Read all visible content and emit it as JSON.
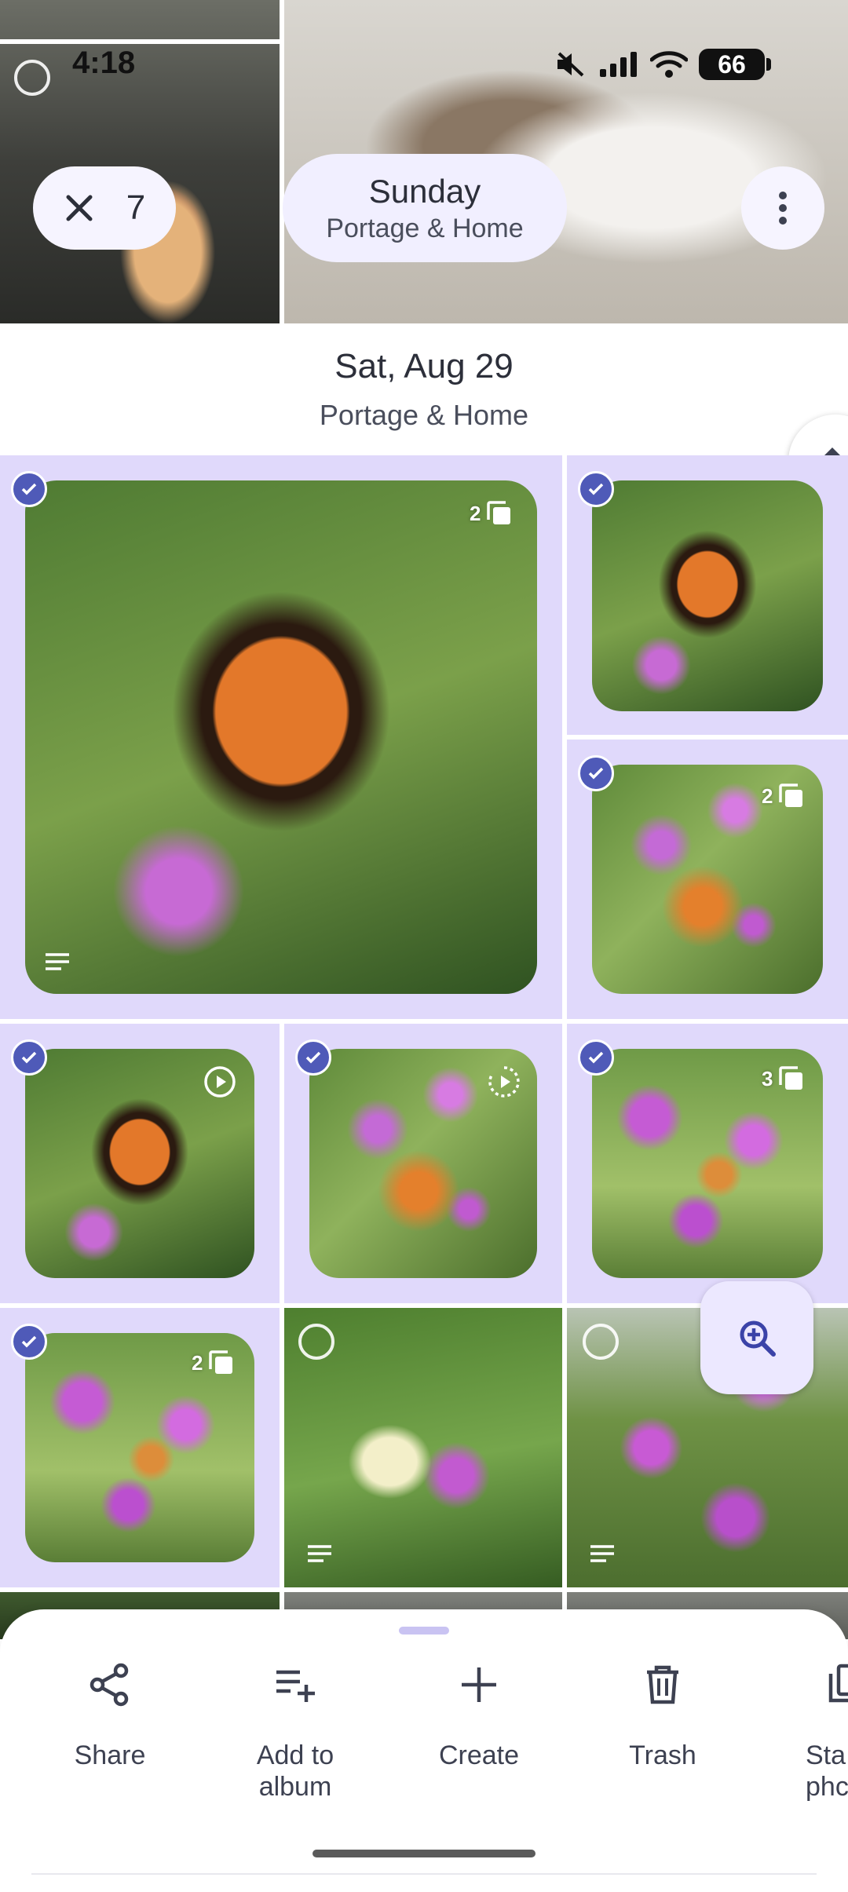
{
  "status_bar": {
    "time": "4:18",
    "battery": "66",
    "icons": [
      "mute-icon",
      "signal-icon",
      "wifi-icon",
      "battery-icon"
    ]
  },
  "selection": {
    "count": "7",
    "close_icon": "close-icon"
  },
  "header_pill": {
    "day": "Sunday",
    "place": "Portage & Home"
  },
  "section": {
    "date": "Sat, Aug 29",
    "place": "Portage & Home"
  },
  "badges": {
    "large_stack": "2",
    "right_second_stack": "2",
    "row3_right_stack": "3",
    "row4_left_stack": "2"
  },
  "actions": [
    {
      "label": "Share",
      "icon": "share-icon"
    },
    {
      "label": "Add to\nalbum",
      "icon": "add-to-album-icon"
    },
    {
      "label": "Create",
      "icon": "plus-icon"
    },
    {
      "label": "Trash",
      "icon": "trash-icon"
    },
    {
      "label": "Sta\nphc",
      "icon": "stack-photos-icon"
    }
  ],
  "colors": {
    "accent": "#4f5ab8",
    "selected_bg": "#e0d9fb",
    "pill_bg": "#f1efff"
  }
}
